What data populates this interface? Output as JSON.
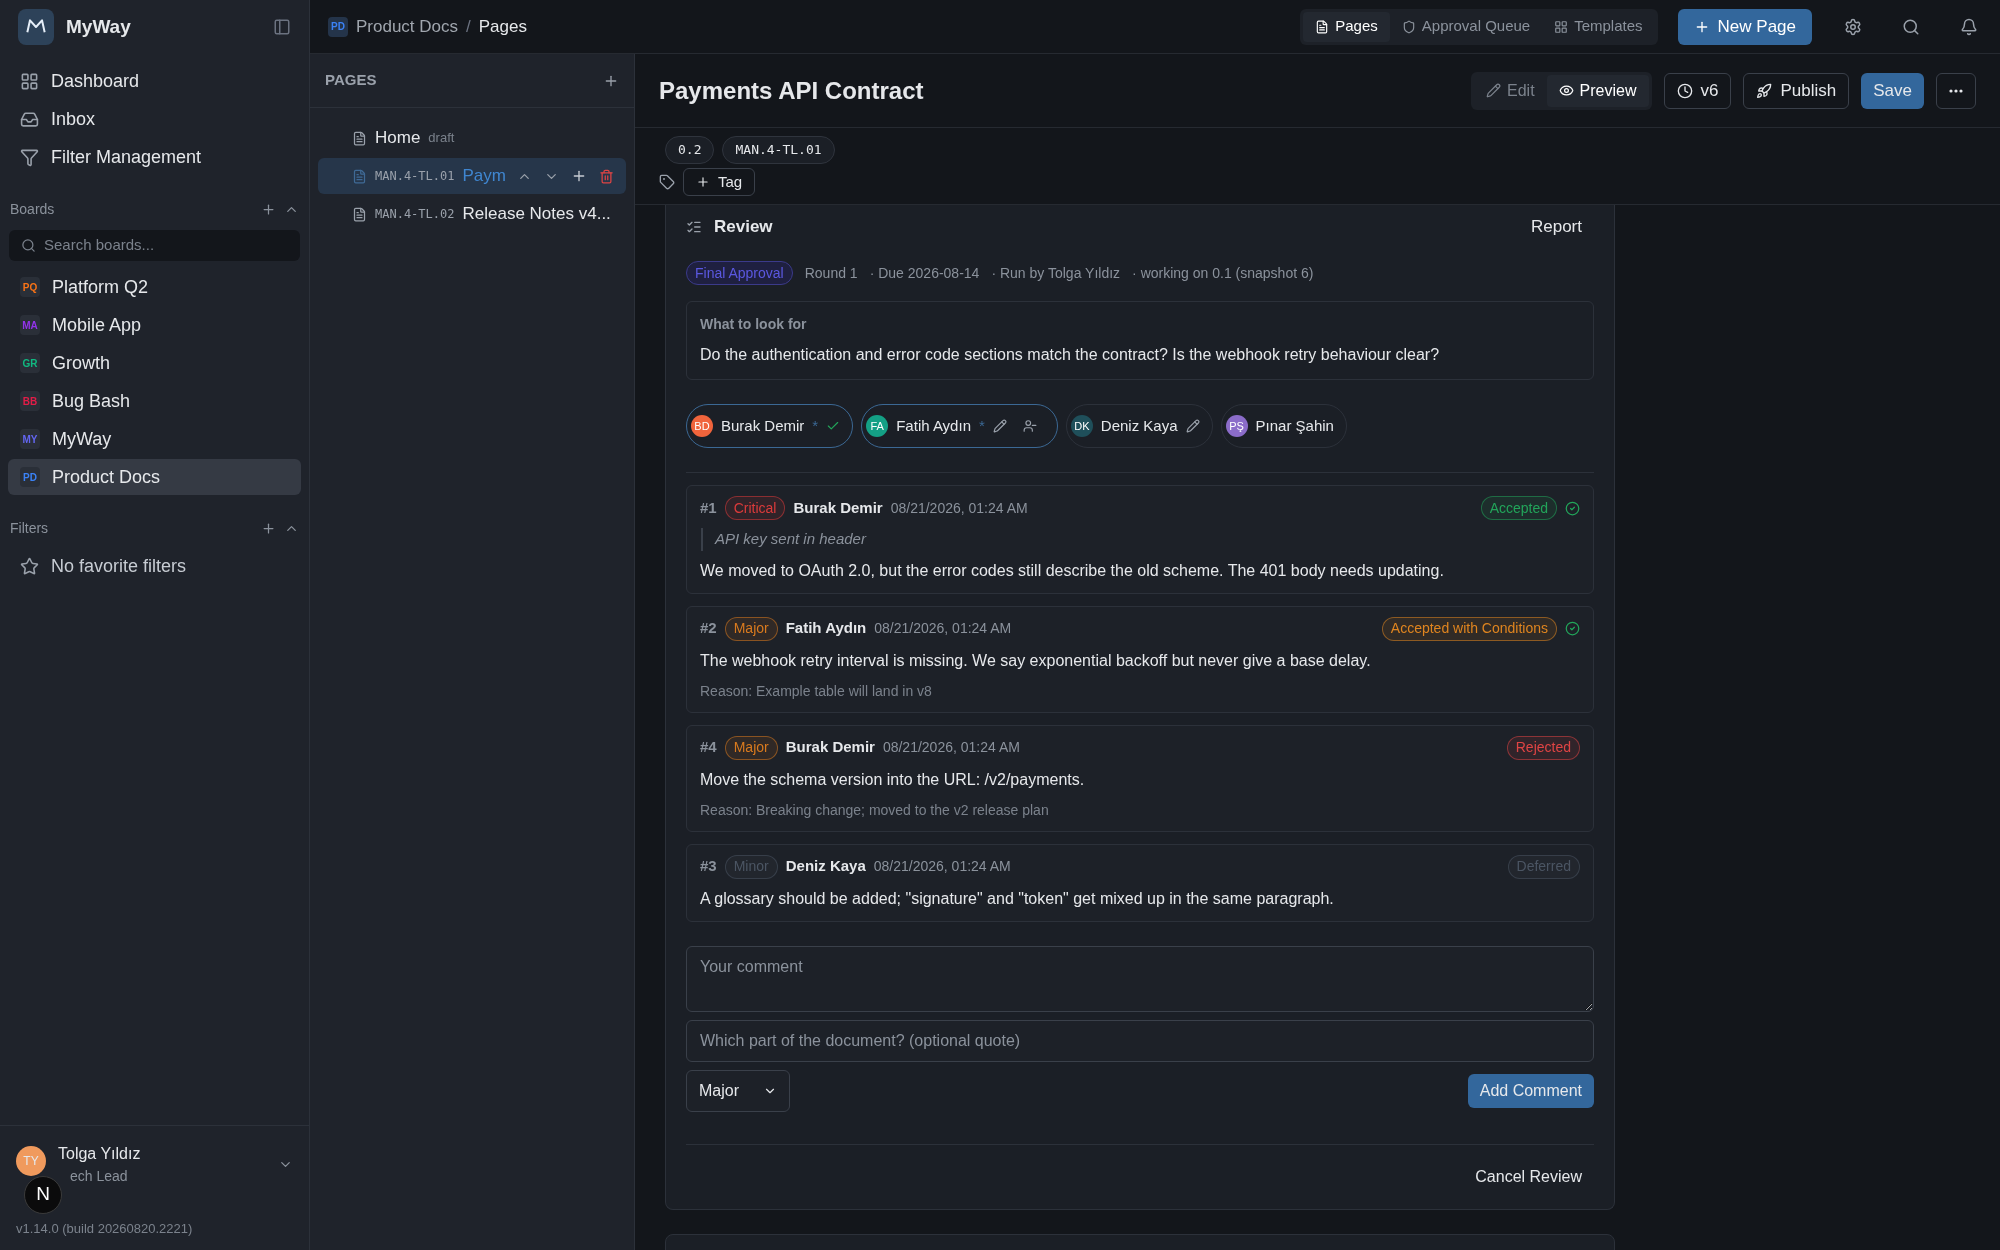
{
  "app": {
    "name": "MyWay"
  },
  "nav": [
    {
      "kind": "dashboard",
      "label": "Dashboard"
    },
    {
      "kind": "inbox",
      "label": "Inbox"
    },
    {
      "kind": "filter",
      "label": "Filter Management"
    }
  ],
  "boards": {
    "title": "Boards",
    "search_placeholder": "Search boards...",
    "items": [
      {
        "initials": "PQ",
        "label": "Platform Q2",
        "color": "#f97316",
        "selected": false
      },
      {
        "initials": "MA",
        "label": "Mobile App",
        "color": "#9333ea",
        "selected": false
      },
      {
        "initials": "GR",
        "label": "Growth",
        "color": "#10b981",
        "selected": false
      },
      {
        "initials": "BB",
        "label": "Bug Bash",
        "color": "#e11d48",
        "selected": false
      },
      {
        "initials": "MY",
        "label": "MyWay",
        "color": "#6366f1",
        "selected": false
      },
      {
        "initials": "PD",
        "label": "Product Docs",
        "color": "#3b82f6",
        "selected": true
      }
    ]
  },
  "filters": {
    "title": "Filters",
    "empty": "No favorite filters"
  },
  "user": {
    "initials": "TY",
    "name": "Tolga Yıldız",
    "role": "ech Lead",
    "version": "v1.14.0 (build 20260820.2221)",
    "dev_badge": "N"
  },
  "breadcrumb": {
    "badge": "PD",
    "parent": "Product Docs",
    "separator": "/",
    "current": "Pages"
  },
  "top_tabs": [
    {
      "kind": "pages",
      "label": "Pages",
      "selected": true
    },
    {
      "kind": "approval",
      "label": "Approval Queue",
      "selected": false
    },
    {
      "kind": "templates",
      "label": "Templates",
      "selected": false
    }
  ],
  "new_page": "New Page",
  "pages_panel": {
    "title": "PAGES",
    "items": [
      {
        "title": "Home",
        "badge": "draft",
        "selected": false
      },
      {
        "code": "MAN.4-TL.01",
        "title": "Paym",
        "selected": true
      },
      {
        "code": "MAN.4-TL.02",
        "title": "Release Notes v4...",
        "selected": false
      }
    ]
  },
  "page": {
    "title": "Payments API Contract",
    "modes": [
      {
        "kind": "edit",
        "label": "Edit",
        "selected": false
      },
      {
        "kind": "preview",
        "label": "Preview",
        "selected": true
      }
    ],
    "version": "v6",
    "publish": "Publish",
    "save": "Save",
    "chips": [
      "0.2",
      "MAN.4-TL.01"
    ],
    "add_tag": "Tag"
  },
  "review": {
    "title": "Review",
    "report": "Report",
    "stage": "Final Approval",
    "meta": [
      "Round 1",
      "· Due 2026-08-14",
      "· Run by Tolga Yıldız",
      "· working on 0.1 (snapshot 6)"
    ],
    "focus_label": "What to look for",
    "focus_text": "Do the authentication and error code sections match the contract? Is the webhook retry behaviour clear?",
    "reviewers": [
      {
        "initials": "BD",
        "name": "Burak Demir",
        "color": "#f0643c",
        "required": "*",
        "selected": true,
        "done": true,
        "editable": false,
        "removable": false
      },
      {
        "initials": "FA",
        "name": "Fatih Aydın",
        "color": "#14a085",
        "required": "*",
        "selected": true,
        "done": false,
        "editable": true,
        "removable": true
      },
      {
        "initials": "DK",
        "name": "Deniz Kaya",
        "color": "#1f4f5a",
        "selected": false,
        "done": false,
        "editable": true,
        "removable": false
      },
      {
        "initials": "PŞ",
        "name": "Pınar Şahin",
        "color": "#8b6cc9",
        "selected": false,
        "done": false,
        "editable": false,
        "removable": false
      }
    ],
    "comments": [
      {
        "number": "#1",
        "severity": {
          "label": "Critical",
          "color": "#dc3b3b"
        },
        "author": "Burak Demir",
        "time": "08/21/2026, 01:24 AM",
        "quote": "API key sent in header",
        "text": "We moved to OAuth 2.0, but the error codes still describe the old scheme. The 401 body needs updating.",
        "status": {
          "label": "Accepted",
          "color": "#22a55a"
        },
        "resolved": true
      },
      {
        "number": "#2",
        "severity": {
          "label": "Major",
          "color": "#d97a1e"
        },
        "author": "Fatih Aydın",
        "time": "08/21/2026, 01:24 AM",
        "text": "The webhook retry interval is missing. We say exponential backoff but never give a base delay.",
        "reason": "Reason: Example table will land in v8",
        "status": {
          "label": "Accepted with Conditions",
          "color": "#e0851f"
        },
        "resolved": true
      },
      {
        "number": "#4",
        "severity": {
          "label": "Major",
          "color": "#d97a1e"
        },
        "author": "Burak Demir",
        "time": "08/21/2026, 01:24 AM",
        "text": "Move the schema version into the URL: /v2/payments.",
        "reason": "Reason: Breaking change; moved to the v2 release plan",
        "status": {
          "label": "Rejected",
          "color": "#e04444"
        },
        "resolved": false
      },
      {
        "number": "#3",
        "severity": {
          "label": "Minor",
          "color": "#4b5563"
        },
        "author": "Deniz Kaya",
        "time": "08/21/2026, 01:24 AM",
        "text": "A glossary should be added; \"signature\" and \"token\" get mixed up in the same paragraph.",
        "status": {
          "label": "Deferred",
          "color": "#4b5563"
        },
        "resolved": false
      }
    ],
    "comment_placeholder": "Your comment",
    "quote_placeholder": "Which part of the document? (optional quote)",
    "severity_value": "Major",
    "add_comment": "Add Comment",
    "cancel": "Cancel Review"
  }
}
